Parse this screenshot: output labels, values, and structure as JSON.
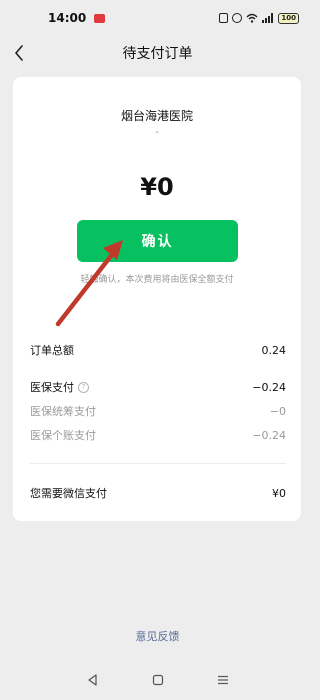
{
  "status_bar": {
    "time": "14:00",
    "battery": "100",
    "icons": [
      "app-badge-icon",
      "nfc-icon",
      "alarm-icon",
      "wifi-icon",
      "signal-icon",
      "battery-icon"
    ]
  },
  "nav": {
    "title": "待支付订单",
    "back_icon": "back-chevron-icon"
  },
  "order": {
    "merchant_name": "烟台海港医院",
    "merchant_sub": "-",
    "amount": "¥0",
    "confirm_label": "确认",
    "confirm_hint": "轻触确认，本次费用将由医保全额支付"
  },
  "breakdown": {
    "total": {
      "label": "订单总额",
      "value": "0.24"
    },
    "insurance": {
      "label": "医保支付",
      "value": "−0.24",
      "help_icon": "?"
    },
    "pooled": {
      "label": "医保统筹支付",
      "value": "−0"
    },
    "personal": {
      "label": "医保个账支付",
      "value": "−0.24"
    },
    "wechat": {
      "label": "您需要微信支付",
      "value": "¥0"
    }
  },
  "feedback": {
    "label": "意见反馈"
  },
  "colors": {
    "accent": "#07c160",
    "arrow": "#c0392b",
    "link": "#576b95",
    "background": "#ededed"
  }
}
